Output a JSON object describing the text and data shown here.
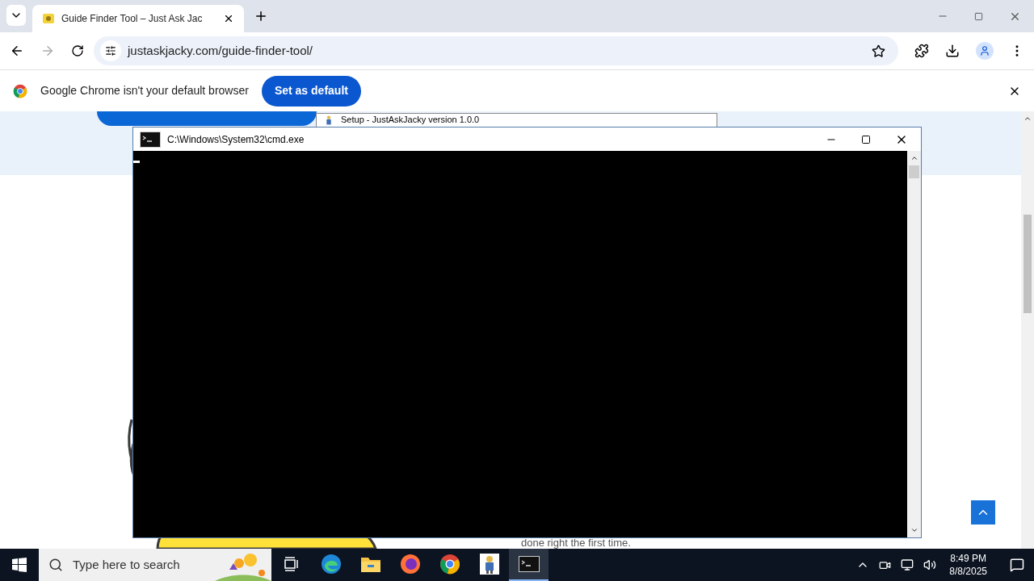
{
  "browser": {
    "tabs": [
      {
        "title": "Guide Finder Tool – Just Ask Jac",
        "selected": true
      }
    ],
    "address": "justaskjacky.com/guide-finder-tool/"
  },
  "infobar": {
    "message": "Google Chrome isn't your default browser",
    "button": "Set as default"
  },
  "page": {
    "caption": "done right the first time."
  },
  "setup_window": {
    "title": "Setup - JustAskJacky version 1.0.0"
  },
  "console_window": {
    "title": "C:\\Windows\\System32\\cmd.exe"
  },
  "taskbar": {
    "search_placeholder": "Type here to search",
    "apps": [
      {
        "kind": "taskview",
        "selected": false
      },
      {
        "kind": "edge",
        "selected": false
      },
      {
        "kind": "explorer",
        "selected": false
      },
      {
        "kind": "firefox",
        "selected": false
      },
      {
        "kind": "chrome",
        "selected": false
      },
      {
        "kind": "setup",
        "selected": false
      },
      {
        "kind": "console",
        "selected": true
      }
    ],
    "time": "8:49 PM",
    "date": "8/8/2025"
  }
}
